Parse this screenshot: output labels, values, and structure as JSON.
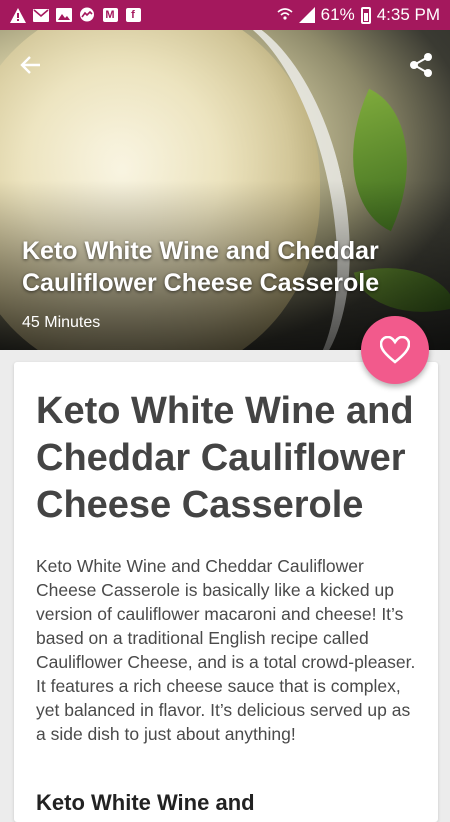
{
  "status_bar": {
    "battery_text": "61%",
    "time": "4:35 PM",
    "notification_icons": [
      "alert-icon",
      "mail-icon",
      "image-icon",
      "messenger-icon",
      "gmail-icon",
      "facebook-icon"
    ],
    "system_icons": [
      "wifi-call-icon",
      "signal-icon",
      "battery-icon"
    ]
  },
  "hero": {
    "title": "Keto White Wine and Cheddar Cauliflower Cheese Casserole",
    "time": "45 Minutes"
  },
  "card": {
    "title": "Keto White Wine and Cheddar Cauliflower Cheese Casserole",
    "description": "Keto White Wine and Cheddar Cauliflower Cheese Casserole is basically like a kicked up version of cauliflower macaroni and cheese! It’s based on a traditional English recipe called Cauliflower Cheese, and is a total crowd-pleaser. It features a rich cheese sauce that is complex, yet balanced in flavor. It’s delicious served up as a side dish to just about anything!",
    "next_heading": "Keto White Wine and"
  },
  "colors": {
    "status_bar": "#a4185d",
    "fab": "#f25a8c",
    "title_text": "#444444"
  }
}
